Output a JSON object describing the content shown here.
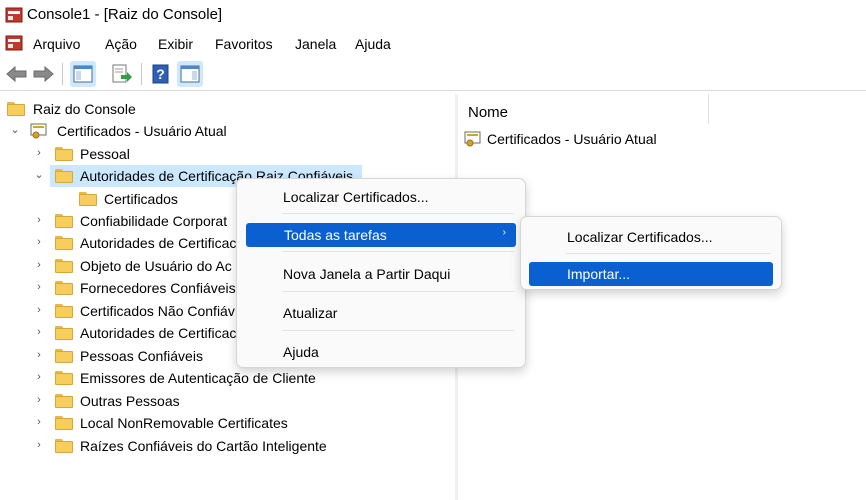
{
  "window": {
    "title": "Console1 - [Raiz do Console]"
  },
  "menu": {
    "items": [
      "Arquivo",
      "Ação",
      "Exibir",
      "Favoritos",
      "Janela",
      "Ajuda"
    ]
  },
  "toolbar": {
    "icons": [
      "back-arrow-icon",
      "forward-arrow-icon",
      "show-hide-tree-icon",
      "export-list-icon",
      "help-icon",
      "show-hide-action-pane-icon"
    ]
  },
  "tree": {
    "root": "Raiz do Console",
    "cert_node": "Certificados - Usuário Atual",
    "items": [
      "Pessoal",
      "Autoridades de Certificação Raiz Confiáveis",
      "Certificados",
      "Confiabilidade Corporat",
      "Autoridades de Certificac",
      "Objeto de Usuário do Ac",
      "Fornecedores Confiáveis",
      "Certificados Não Confiáv",
      "Autoridades de Certificac",
      "Pessoas Confiáveis",
      "Emissores de Autenticação de Cliente",
      "Outras Pessoas",
      "Local NonRemovable Certificates",
      "Raízes Confiáveis do Cartão Inteligente"
    ]
  },
  "list": {
    "column_header": "Nome",
    "items": [
      "Certificados - Usuário Atual"
    ]
  },
  "context_menu": {
    "items": [
      "Localizar Certificados...",
      "Todas as tarefas",
      "Nova Janela a Partir Daqui",
      "Atualizar",
      "Ajuda"
    ]
  },
  "submenu": {
    "items": [
      "Localizar Certificados...",
      "Importar..."
    ]
  },
  "colors": {
    "highlight": "#0a5fd1",
    "selection": "#cce8ff",
    "folder": "#f7cd5b"
  }
}
